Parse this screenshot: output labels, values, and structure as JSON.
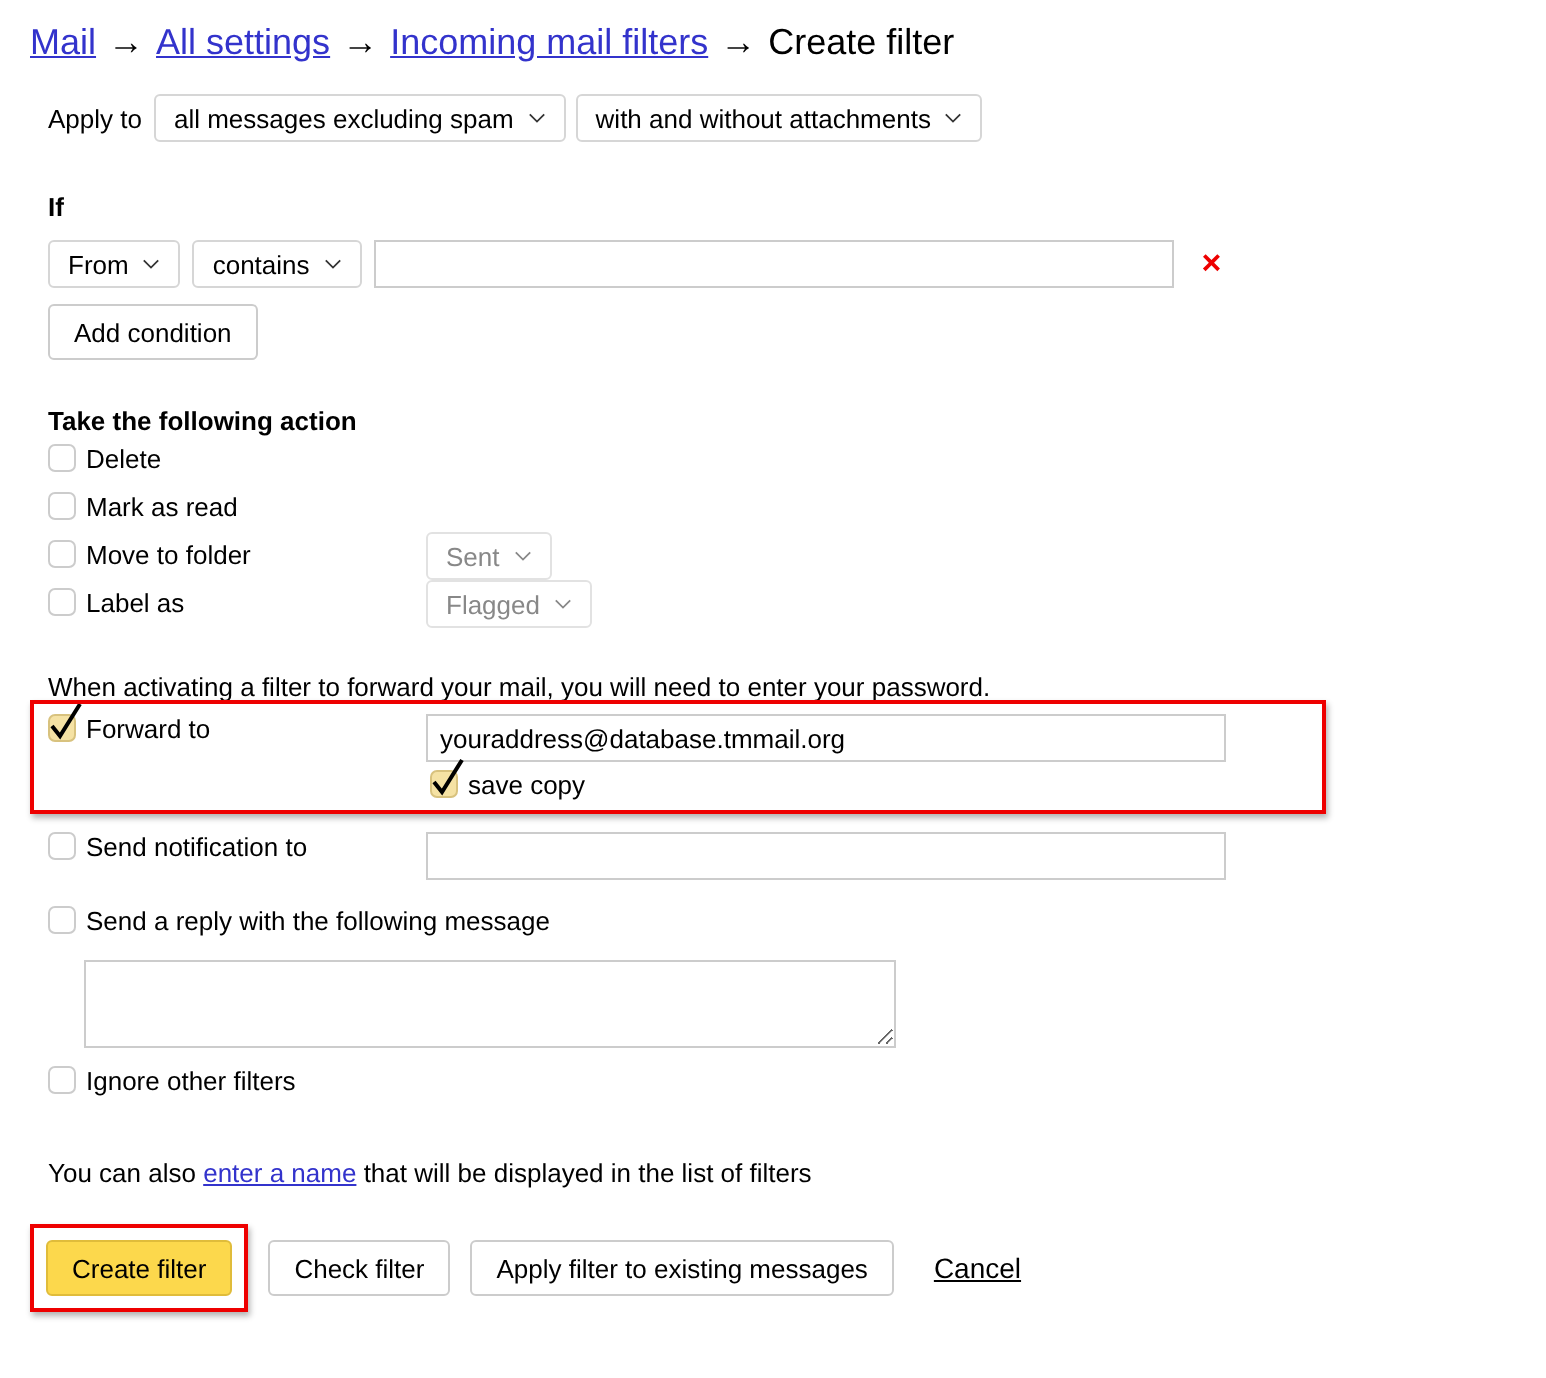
{
  "breadcrumb": [
    {
      "kind": "link",
      "text": "Mail"
    },
    {
      "kind": "separator",
      "text": "→"
    },
    {
      "kind": "link",
      "text": "All settings"
    },
    {
      "kind": "separator",
      "text": "→"
    },
    {
      "kind": "link",
      "text": "Incoming mail filters"
    },
    {
      "kind": "separator",
      "text": "→"
    },
    {
      "kind": "current",
      "text": "Create filter"
    }
  ],
  "apply_to": {
    "label": "Apply to",
    "selects": [
      "all messages excluding spam",
      "with and without attachments"
    ]
  },
  "condition": {
    "heading": "If",
    "field": "From",
    "operator": "contains",
    "remove": "×",
    "add_button": "Add condition"
  },
  "actions_heading": "Take the following action",
  "actions": [
    {
      "kind": "plain",
      "label": "Delete",
      "checked": false
    },
    {
      "kind": "plain",
      "label": "Mark as read",
      "checked": false
    },
    {
      "kind": "select",
      "label": "Move to folder",
      "checked": false,
      "select": "Sent"
    },
    {
      "kind": "select",
      "label": "Label as",
      "checked": false,
      "select": "Flagged"
    },
    {
      "kind": "note",
      "label": "When activating a filter to forward your mail, you will need to enter your password."
    },
    {
      "kind": "forward",
      "label": "Forward to",
      "checked": true,
      "value": "youraddress@database.tmmail.org",
      "save_copy": {
        "label": "save copy",
        "checked": true
      },
      "highlighted": true
    },
    {
      "kind": "field",
      "label": "Send notification to",
      "checked": false
    },
    {
      "kind": "textarea",
      "label": "Send a reply with the following message",
      "checked": false
    },
    {
      "kind": "plain",
      "label": "Ignore other filters",
      "checked": false
    }
  ],
  "name_hint": {
    "before": "You can also",
    "link": "enter a name",
    "after": "that will be displayed in the list of filters"
  },
  "buttons": [
    {
      "kind": "primary",
      "label": "Create filter",
      "highlighted": true
    },
    {
      "kind": "default",
      "label": "Check filter",
      "highlighted": false
    },
    {
      "kind": "default",
      "label": "Apply filter to existing messages",
      "highlighted": false
    },
    {
      "kind": "link",
      "label": "Cancel",
      "highlighted": false
    }
  ]
}
